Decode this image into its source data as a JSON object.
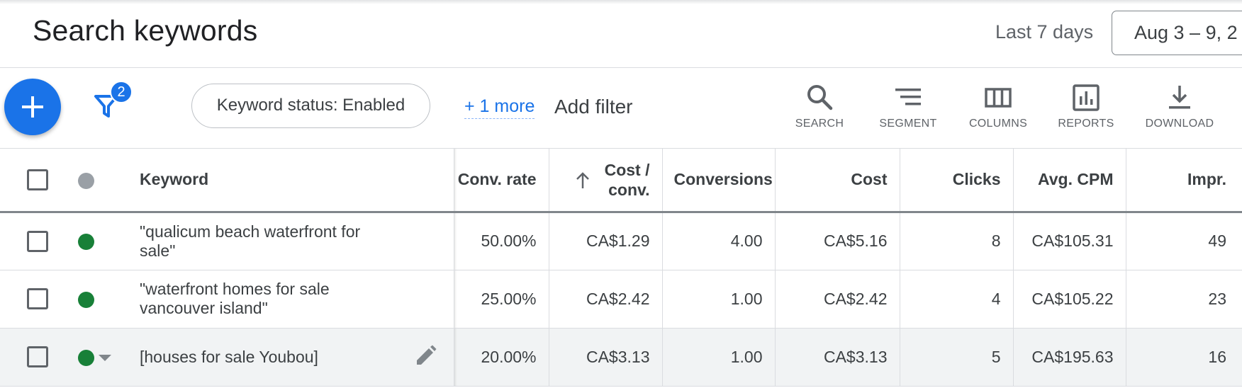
{
  "header": {
    "title": "Search keywords",
    "range_label": "Last 7 days",
    "date_range": "Aug 3 – 9, 2"
  },
  "toolbar": {
    "filter_count": "2",
    "status_chip": "Keyword status: Enabled",
    "more_filters": "+ 1 more",
    "add_filter": "Add filter",
    "tools": [
      {
        "label": "SEARCH",
        "icon": "search-icon"
      },
      {
        "label": "SEGMENT",
        "icon": "segment-icon"
      },
      {
        "label": "COLUMNS",
        "icon": "columns-icon"
      },
      {
        "label": "REPORTS",
        "icon": "reports-icon"
      },
      {
        "label": "DOWNLOAD",
        "icon": "download-icon"
      }
    ]
  },
  "table": {
    "columns": {
      "keyword": "Keyword",
      "conv_rate": "Conv. rate",
      "cost_per_conv_1": "Cost /",
      "cost_per_conv_2": "conv.",
      "conversions": "Conversions",
      "cost": "Cost",
      "clicks": "Clicks",
      "avg_cpm": "Avg. CPM",
      "impr": "Impr."
    },
    "rows": [
      {
        "keyword_1": "\"qualicum beach waterfront for",
        "keyword_2": "sale\"",
        "conv_rate": "50.00%",
        "cost_per_conv": "CA$1.29",
        "conversions": "4.00",
        "cost": "CA$5.16",
        "clicks": "8",
        "avg_cpm": "CA$105.31",
        "impr": "49"
      },
      {
        "keyword_1": "\"waterfront homes for sale",
        "keyword_2": "vancouver island\"",
        "conv_rate": "25.00%",
        "cost_per_conv": "CA$2.42",
        "conversions": "1.00",
        "cost": "CA$2.42",
        "clicks": "4",
        "avg_cpm": "CA$105.22",
        "impr": "23"
      },
      {
        "keyword_1": "[houses for sale Youbou]",
        "keyword_2": "",
        "conv_rate": "20.00%",
        "cost_per_conv": "CA$3.13",
        "conversions": "1.00",
        "cost": "CA$3.13",
        "clicks": "5",
        "avg_cpm": "CA$195.63",
        "impr": "16"
      }
    ]
  },
  "colors": {
    "accent": "#1a73e8",
    "enabled": "#188038",
    "status_header": "#9aa0a6"
  }
}
